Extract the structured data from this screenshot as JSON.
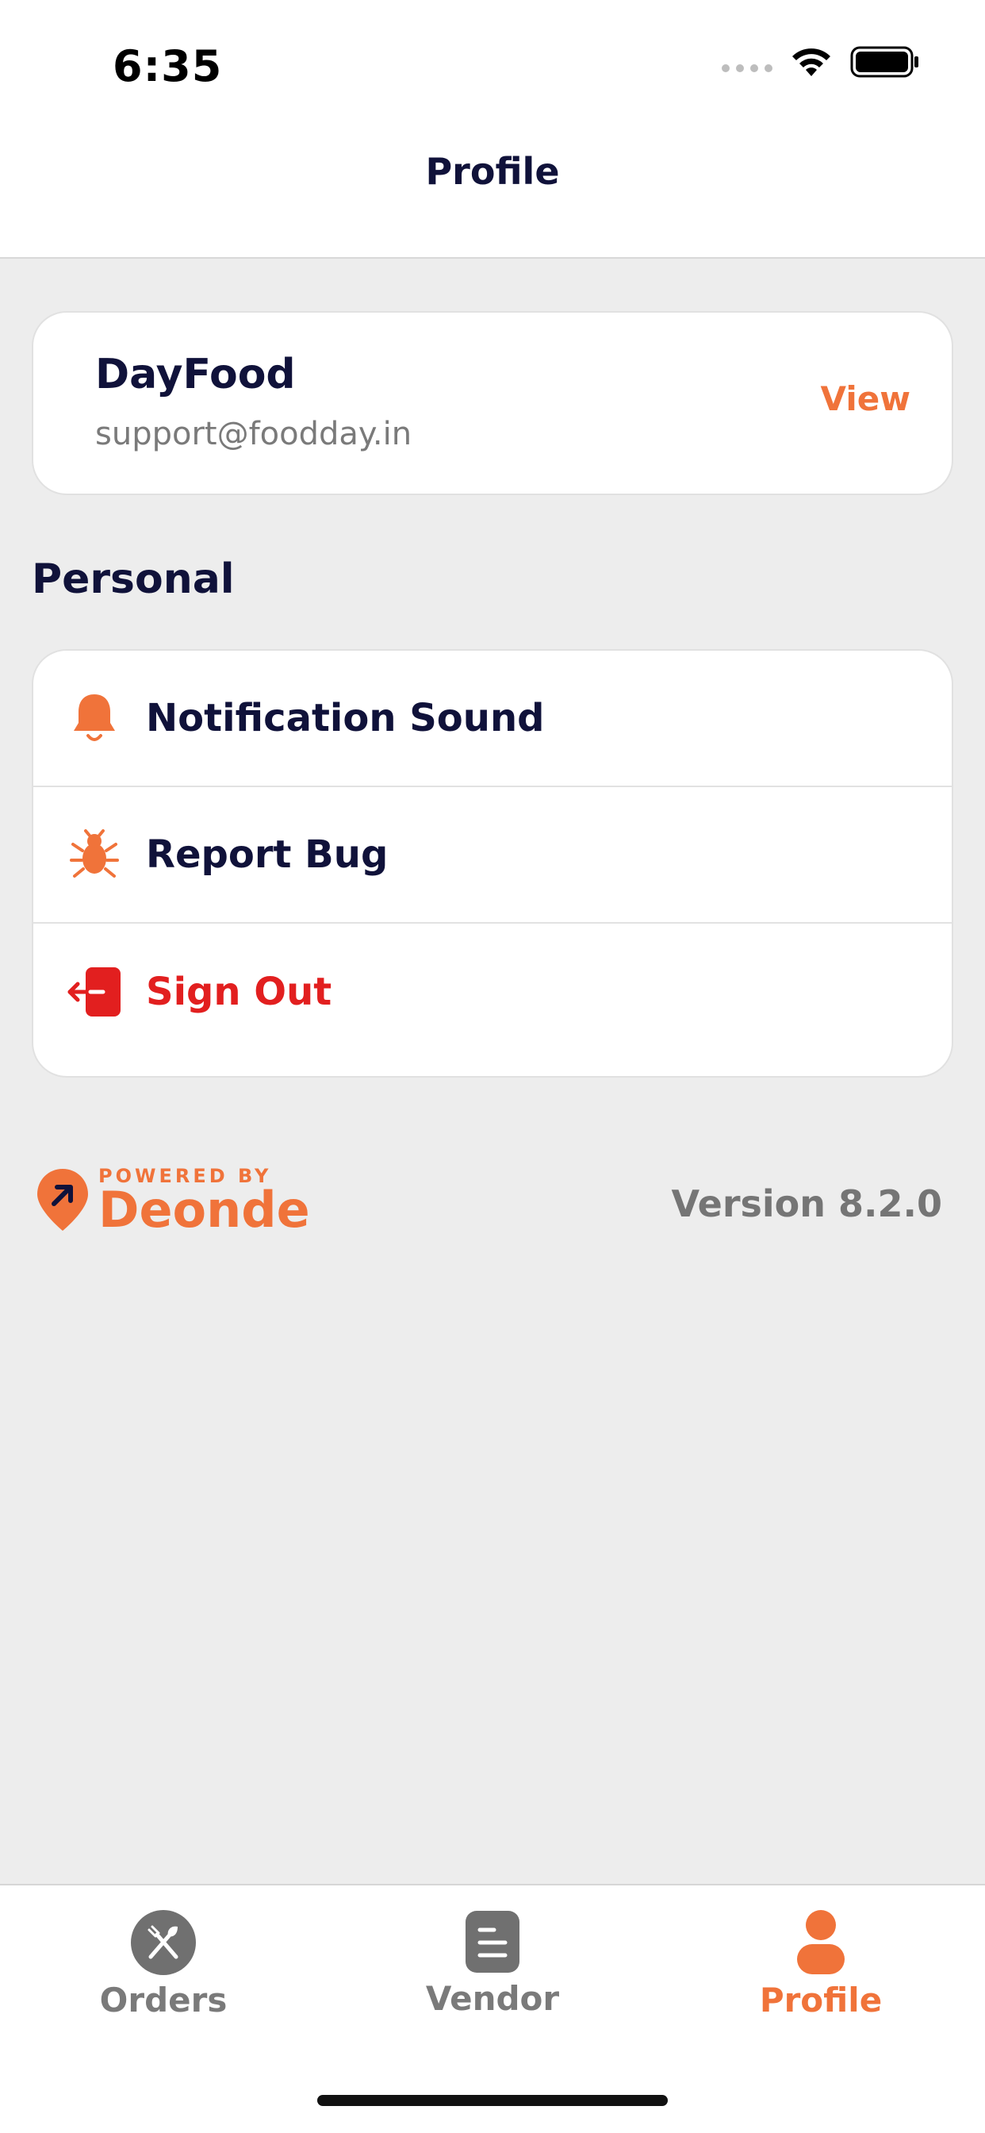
{
  "status_bar": {
    "time": "6:35"
  },
  "header": {
    "title": "Profile"
  },
  "account": {
    "name": "DayFood",
    "email": "support@foodday.in",
    "view_label": "View"
  },
  "personal": {
    "section_title": "Personal",
    "items": [
      {
        "label": "Notification Sound",
        "icon": "bell-icon"
      },
      {
        "label": "Report Bug",
        "icon": "bug-icon"
      },
      {
        "label": "Sign Out",
        "icon": "sign-out-icon"
      }
    ]
  },
  "footer": {
    "powered_by": "POWERED BY",
    "brand": "Deonde",
    "version": "Version 8.2.0"
  },
  "tab_bar": {
    "tabs": [
      {
        "label": "Orders",
        "icon": "utensils-icon",
        "active": false
      },
      {
        "label": "Vendor",
        "icon": "document-icon",
        "active": false
      },
      {
        "label": "Profile",
        "icon": "person-icon",
        "active": true
      }
    ]
  },
  "colors": {
    "accent": "#f0733a",
    "danger": "#e21f1f",
    "text_primary": "#10123a",
    "text_secondary": "#7a7a7a",
    "background": "#ededed"
  }
}
